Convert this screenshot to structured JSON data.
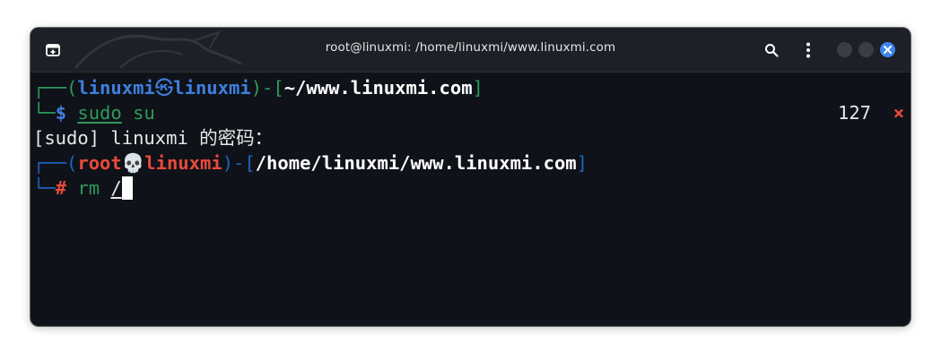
{
  "window": {
    "title": "root@linuxmi: /home/linuxmi/www.linuxmi.com"
  },
  "icons": {
    "new_tab": "new-tab-icon",
    "search": "search-icon",
    "menu": "vertical-dots-icon",
    "close": "close-icon",
    "logo": "kali-dragon-icon"
  },
  "colors": {
    "accent_close": "#3a86ea",
    "prompt_green": "#2e9a5c",
    "prompt_blue": "#3f7fe0",
    "root_red": "#ea4a3c",
    "terminal_bg": "#0f1218"
  },
  "terminal": {
    "prompt1": {
      "corner_top": "┌──(",
      "user": "linuxmi",
      "symbol": "㉿",
      "host": "linuxmi",
      "bracket_mid": ")-[",
      "path": "~/www.linuxmi.com",
      "bracket_close": "]",
      "corner_bottom": "└─",
      "prompt_char": "$",
      "cmd": "sudo",
      "arg": "su",
      "exit_code": "127",
      "exit_mark": "×"
    },
    "sudo_line": "[sudo] linuxmi 的密码：",
    "prompt2": {
      "corner_top": "┌──(",
      "user": "root",
      "symbol": "💀",
      "host": "linuxmi",
      "bracket_mid": ")-[",
      "path": "/home/linuxmi/www.linuxmi.com",
      "bracket_close": "]",
      "corner_bottom": "└─",
      "prompt_char": "#",
      "cmd": "rm",
      "arg": "/"
    }
  }
}
